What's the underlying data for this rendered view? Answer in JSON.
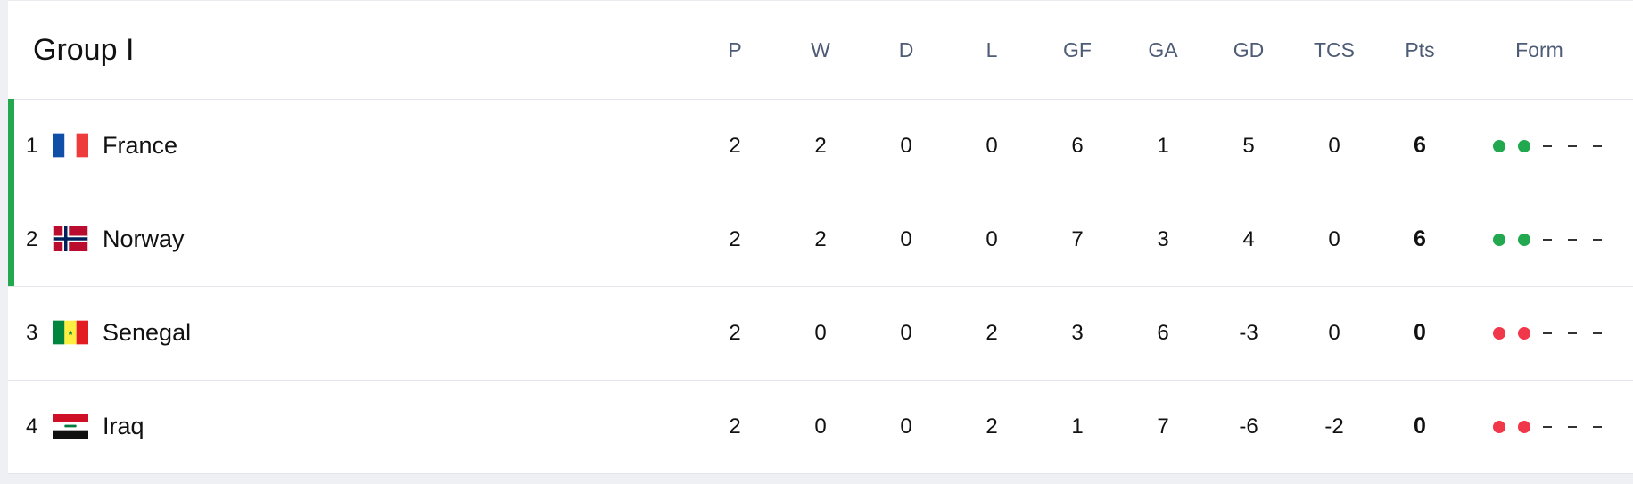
{
  "group_title": "Group I",
  "columns": [
    "P",
    "W",
    "D",
    "L",
    "GF",
    "GA",
    "GD",
    "TCS",
    "Pts",
    "Form"
  ],
  "colors": {
    "win": "#22a94f",
    "loss": "#f0384a",
    "qualified": "#22a94f"
  },
  "teams": [
    {
      "rank": "1",
      "name": "France",
      "flag": "france-flag-icon",
      "qualified": true,
      "stats": [
        "2",
        "2",
        "0",
        "0",
        "6",
        "1",
        "5",
        "0"
      ],
      "pts": "6",
      "form": [
        "win",
        "win",
        "none",
        "none",
        "none"
      ]
    },
    {
      "rank": "2",
      "name": "Norway",
      "flag": "norway-flag-icon",
      "qualified": true,
      "stats": [
        "2",
        "2",
        "0",
        "0",
        "7",
        "3",
        "4",
        "0"
      ],
      "pts": "6",
      "form": [
        "win",
        "win",
        "none",
        "none",
        "none"
      ]
    },
    {
      "rank": "3",
      "name": "Senegal",
      "flag": "senegal-flag-icon",
      "qualified": false,
      "stats": [
        "2",
        "0",
        "0",
        "2",
        "3",
        "6",
        "-3",
        "0"
      ],
      "pts": "0",
      "form": [
        "loss",
        "loss",
        "none",
        "none",
        "none"
      ]
    },
    {
      "rank": "4",
      "name": "Iraq",
      "flag": "iraq-flag-icon",
      "qualified": false,
      "stats": [
        "2",
        "0",
        "0",
        "2",
        "1",
        "7",
        "-6",
        "-2"
      ],
      "pts": "0",
      "form": [
        "loss",
        "loss",
        "none",
        "none",
        "none"
      ]
    }
  ]
}
